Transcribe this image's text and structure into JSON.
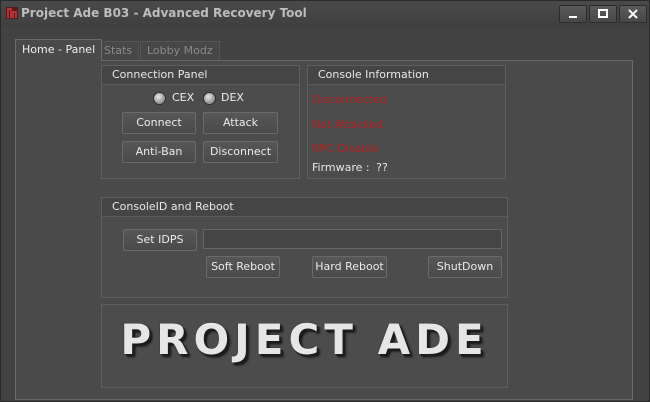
{
  "window": {
    "title": "Project Ade B03 - Advanced Recovery Tool",
    "icon": "app-logo-icon",
    "controls": [
      "minimize-icon",
      "maximize-icon",
      "close-icon"
    ]
  },
  "tabs": [
    {
      "label": "Home - Panel",
      "active": true
    },
    {
      "label": "Stats",
      "active": false
    },
    {
      "label": "Lobby Modz",
      "active": false
    }
  ],
  "connection_panel": {
    "title": "Connection Panel",
    "cex_label": "CEX",
    "dex_label": "DEX",
    "connect_label": "Connect",
    "attack_label": "Attack",
    "antiban_label": "Anti-Ban",
    "disconnect_label": "Disconnect"
  },
  "console_info": {
    "title": "Console Information",
    "status_connection": "Disconnected",
    "status_attack": "Not Attacked",
    "status_rpc": "RPC Disable",
    "firmware_label": "Firmware :",
    "firmware_value": "??",
    "status_color": "#b41e1e"
  },
  "consoleid": {
    "title": "ConsoleID and Reboot",
    "set_idps_label": "Set IDPS",
    "idps_value": "",
    "soft_reboot_label": "Soft Reboot",
    "hard_reboot_label": "Hard Reboot",
    "shutdown_label": "ShutDown"
  },
  "banner": {
    "text": "PROJECT ADE"
  }
}
